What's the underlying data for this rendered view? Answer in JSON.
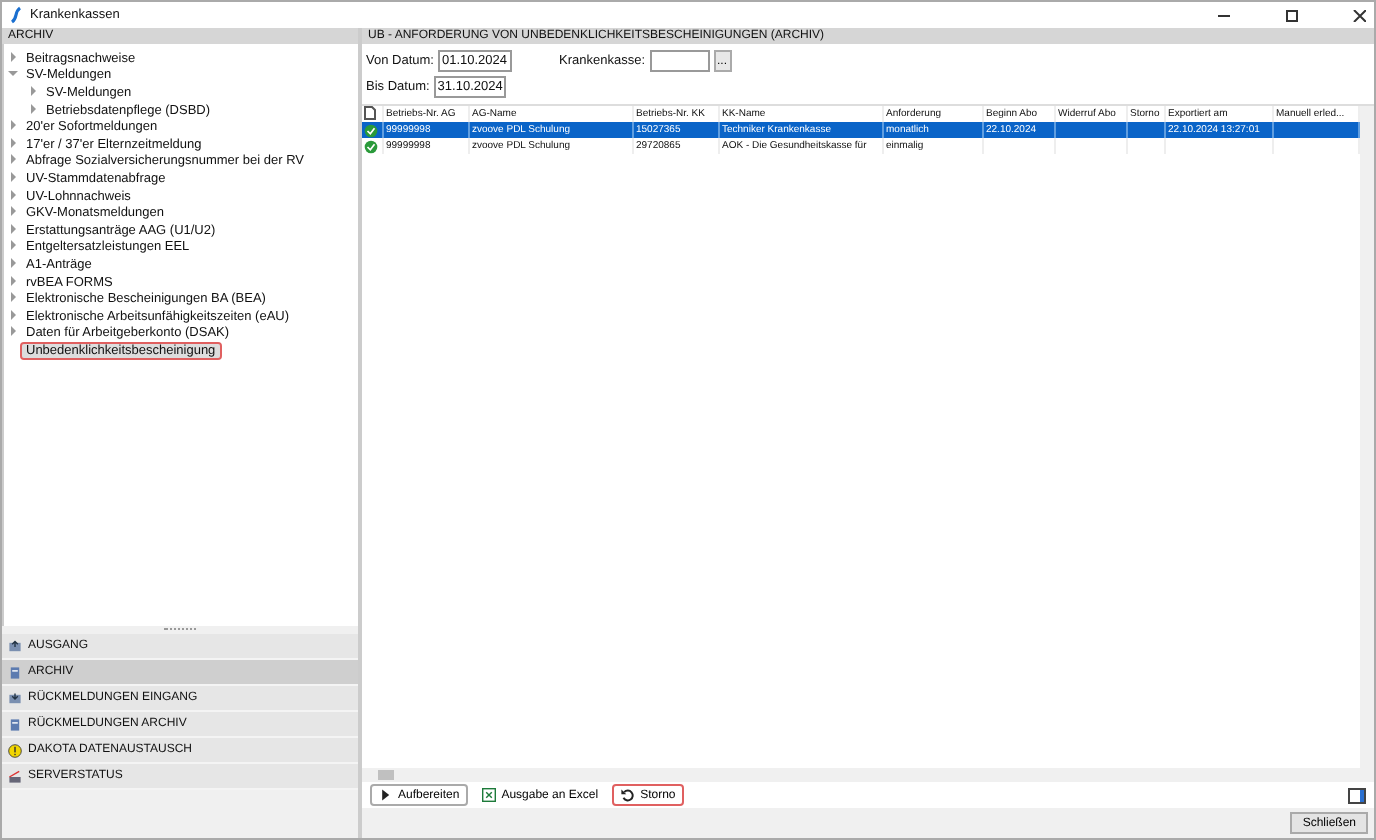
{
  "window": {
    "title": "Krankenkassen"
  },
  "sidebar": {
    "title": "ARCHIV",
    "tree": [
      {
        "label": "Beitragsnachweise",
        "expanded": false,
        "selected": false
      },
      {
        "label": "SV-Meldungen",
        "expanded": true,
        "selected": false,
        "children": [
          {
            "label": "SV-Meldungen",
            "expanded": false,
            "selected": false
          },
          {
            "label": "Betriebsdatenpflege (DSBD)",
            "expanded": false,
            "selected": false
          }
        ]
      },
      {
        "label": "20'er Sofortmeldungen",
        "expanded": false,
        "selected": false
      },
      {
        "label": "17'er / 37'er Elternzeitmeldung",
        "expanded": false,
        "selected": false
      },
      {
        "label": "Abfrage Sozialversicherungsnummer bei der RV",
        "expanded": false,
        "selected": false
      },
      {
        "label": "UV-Stammdatenabfrage",
        "expanded": false,
        "selected": false
      },
      {
        "label": "UV-Lohnnachweis",
        "expanded": false,
        "selected": false
      },
      {
        "label": "GKV-Monatsmeldungen",
        "expanded": false,
        "selected": false
      },
      {
        "label": "Erstattungsanträge AAG (U1/U2)",
        "expanded": false,
        "selected": false
      },
      {
        "label": "Entgeltersatzleistungen EEL",
        "expanded": false,
        "selected": false
      },
      {
        "label": "A1-Anträge",
        "expanded": false,
        "selected": false
      },
      {
        "label": "rvBEA FORMS",
        "expanded": false,
        "selected": false
      },
      {
        "label": "Elektronische Bescheinigungen BA (BEA)",
        "expanded": false,
        "selected": false
      },
      {
        "label": "Elektronische Arbeitsunfähigkeitszeiten (eAU)",
        "expanded": false,
        "selected": false
      },
      {
        "label": "Daten für Arbeitgeberkonto (DSAK)",
        "expanded": false,
        "selected": false
      },
      {
        "label": "Unbedenklichkeitsbescheinigung",
        "selected": true
      }
    ],
    "nav": [
      {
        "label": "AUSGANG",
        "kind": "outbox",
        "selected": false
      },
      {
        "label": "ARCHIV",
        "kind": "archive",
        "selected": true
      },
      {
        "label": "RÜCKMELDUNGEN EINGANG",
        "kind": "inbox",
        "selected": false
      },
      {
        "label": "RÜCKMELDUNGEN ARCHIV",
        "kind": "archive",
        "selected": false
      },
      {
        "label": "DAKOTA DATENAUSTAUSCH",
        "kind": "warning",
        "selected": false
      },
      {
        "label": "SERVERSTATUS",
        "kind": "server",
        "selected": false
      }
    ]
  },
  "main": {
    "title": "UB - ANFORDERUNG VON UNBEDENKLICHKEITSBESCHEINIGUNGEN (ARCHIV)",
    "filters": {
      "von_label": "Von Datum:",
      "von_value": "01.10.2024",
      "bis_label": "Bis Datum:",
      "bis_value": "31.10.2024",
      "kk_label": "Krankenkasse:",
      "kk_button": "..."
    },
    "table": {
      "columns": [
        "Betriebs-Nr. AG",
        "AG-Name",
        "Betriebs-Nr. KK",
        "KK-Name",
        "Anforderung",
        "Beginn Abo",
        "Widerruf Abo",
        "Storno",
        "Exportiert am",
        "Manuell erled..."
      ],
      "rows": [
        {
          "selected": true,
          "kind": "ok",
          "cells": [
            "99999998",
            "zvoove PDL Schulung",
            "15027365",
            "Techniker Krankenkasse",
            "monatlich",
            "22.10.2024",
            "",
            "",
            "22.10.2024 13:27:01",
            ""
          ]
        },
        {
          "selected": false,
          "kind": "ok",
          "cells": [
            "99999998",
            "zvoove PDL Schulung",
            "29720865",
            "AOK - Die Gesundheitskasse für",
            "einmalig",
            "",
            "",
            "",
            "",
            ""
          ]
        }
      ]
    },
    "toolbar": [
      {
        "label": "Aufbereiten",
        "kind": "play",
        "highlighted": false
      },
      {
        "label": "Ausgabe an Excel",
        "kind": "excel",
        "highlighted": false
      },
      {
        "label": "Storno",
        "kind": "undo",
        "highlighted": true
      }
    ],
    "close_button": "Schließen"
  }
}
